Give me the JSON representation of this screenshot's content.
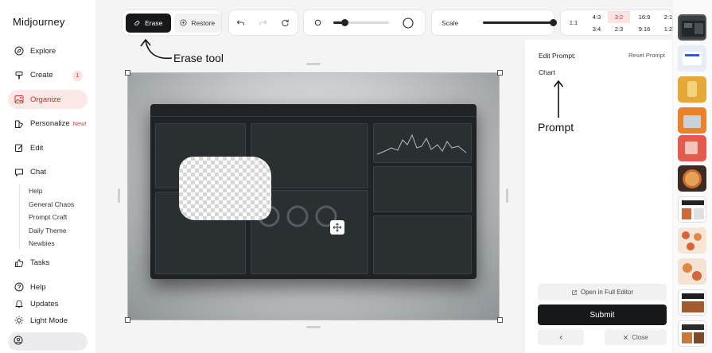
{
  "app": {
    "title": "Midjourney"
  },
  "sidebar": {
    "items": [
      {
        "label": "Explore",
        "icon": "compass-icon"
      },
      {
        "label": "Create",
        "icon": "brush-icon",
        "badge": "1"
      },
      {
        "label": "Organize",
        "icon": "image-icon",
        "active": true
      },
      {
        "label": "Personalize",
        "icon": "palette-icon",
        "tag": "New!"
      },
      {
        "label": "Edit",
        "icon": "edit-icon"
      },
      {
        "label": "Chat",
        "icon": "chat-icon"
      }
    ],
    "chat_rooms": [
      "Help",
      "General Chaos",
      "Prompt Craft",
      "Daily Theme",
      "Newbies"
    ],
    "bottom_items": [
      {
        "label": "Tasks",
        "icon": "thumbs-up-icon"
      },
      {
        "label": "Help",
        "icon": "help-icon"
      },
      {
        "label": "Updates",
        "icon": "bell-icon"
      },
      {
        "label": "Light Mode",
        "icon": "sun-icon"
      }
    ]
  },
  "toolbar": {
    "erase_label": "Erase",
    "restore_label": "Restore",
    "scale_label": "Scale",
    "brush_size_level": 0.2,
    "scale_level": 1.0,
    "ratios": {
      "first": "1:1",
      "grid": [
        [
          "4:3",
          "3:2",
          "16:9",
          "2:1"
        ],
        [
          "3:4",
          "2:3",
          "9:16",
          "1:2"
        ]
      ],
      "selected": "3:2"
    }
  },
  "annotations": {
    "erase_tool": "Erase tool",
    "prompt": "Prompt"
  },
  "editor": {
    "edit_prompt_label": "Edit Prompt:",
    "reset_prompt_label": "Reset Prompt",
    "prompt_value": "Chart",
    "full_editor_label": "Open in Full Editor",
    "submit_label": "Submit",
    "close_label": "Close"
  },
  "colors": {
    "accent": "#e23b3b",
    "active_bg": "#fde8e8",
    "dark_button": "#17181a"
  }
}
